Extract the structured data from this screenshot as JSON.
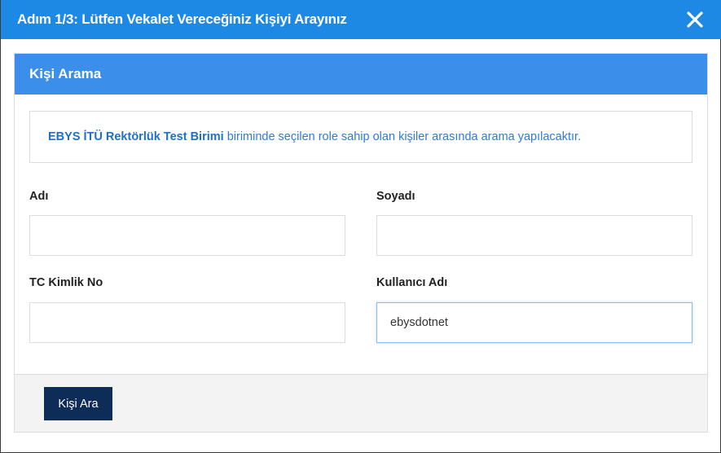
{
  "modal": {
    "title": "Adım 1/3: Lütfen Vekalet Vereceğiniz Kişiyi Arayınız",
    "close_icon": "close-icon"
  },
  "panel": {
    "title": "Kişi Arama",
    "info": {
      "unit_name": "EBYS İTÜ Rektörlük Test Birimi",
      "message": " biriminde seçilen role sahip olan kişiler arasında arama yapılacaktır."
    },
    "fields": {
      "first_name": {
        "label": "Adı",
        "value": ""
      },
      "last_name": {
        "label": "Soyadı",
        "value": ""
      },
      "tc_no": {
        "label": "TC Kimlik No",
        "value": ""
      },
      "username": {
        "label": "Kullanıcı Adı",
        "value": "ebysdotnet"
      }
    },
    "search_button": "Kişi Ara"
  },
  "colors": {
    "header": "#1e88e5",
    "panel_header": "#3b8fea",
    "button": "#0d2c57",
    "link_text": "#2d7bd3"
  }
}
